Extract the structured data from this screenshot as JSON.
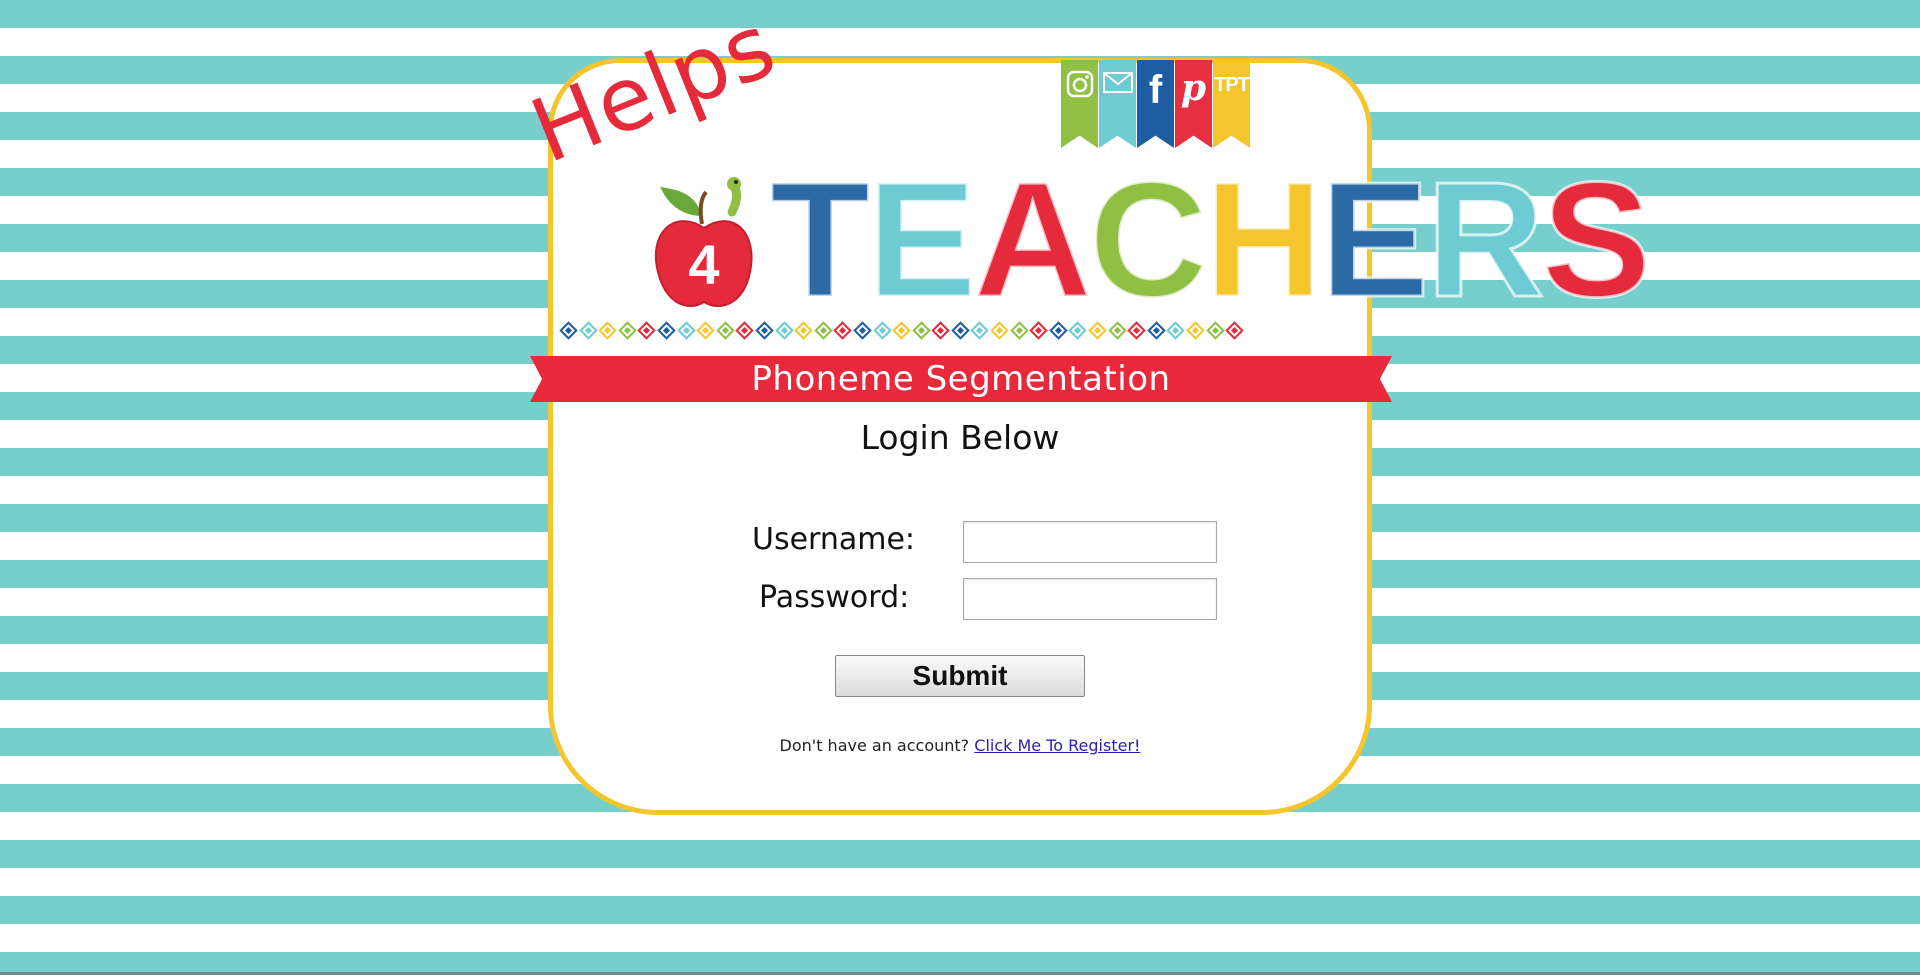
{
  "social": [
    {
      "name": "instagram",
      "label": "",
      "icon": "instagram-icon",
      "color": "#8fc044"
    },
    {
      "name": "email",
      "label": "",
      "icon": "envelope-icon",
      "color": "#6ccbd3"
    },
    {
      "name": "facebook",
      "label": "f",
      "icon": "facebook-icon",
      "color": "#1f5da3"
    },
    {
      "name": "pinterest",
      "label": "p",
      "icon": "pinterest-icon",
      "color": "#e63040"
    },
    {
      "name": "tpt",
      "label": "TPT",
      "icon": "tpt-icon",
      "color": "#f4c52c"
    }
  ],
  "logo": {
    "helps": "Helps",
    "number": "4",
    "teachers_letters": [
      {
        "char": "T",
        "color": "#2c6aa6"
      },
      {
        "char": "E",
        "color": "#6ccbd3"
      },
      {
        "char": "A",
        "color": "#e52a3b"
      },
      {
        "char": "C",
        "color": "#8fc044"
      },
      {
        "char": "H",
        "color": "#f4c52c"
      },
      {
        "char": "E",
        "color": "#2c6aa6"
      },
      {
        "char": "R",
        "color": "#6ccbd3"
      },
      {
        "char": "S",
        "color": "#e52a3b"
      }
    ]
  },
  "banner": {
    "title": "Phoneme Segmentation"
  },
  "login": {
    "heading": "Login Below",
    "username_label": "Username:",
    "password_label": "Password:",
    "username_value": "",
    "password_value": "",
    "submit_label": "Submit",
    "register_prompt": "Don't have an account?",
    "register_link": "Click Me To Register!"
  },
  "colors": {
    "stripe": "#77cfcd",
    "card_border": "#f4c52c",
    "banner": "#e8293b",
    "link": "#2a1fb5"
  }
}
